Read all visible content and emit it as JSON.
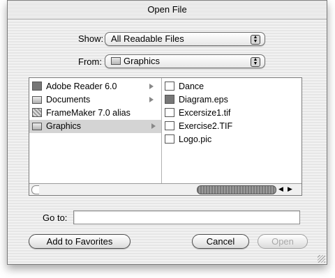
{
  "window": {
    "title": "Open File"
  },
  "show": {
    "label": "Show:",
    "value": "All Readable Files"
  },
  "from": {
    "label": "From:",
    "value": "Graphics"
  },
  "browser": {
    "column1": [
      {
        "label": "Adobe Reader 6.0",
        "icon": "app-icon"
      },
      {
        "label": "Documents",
        "icon": "folder-icon"
      },
      {
        "label": "FrameMaker 7.0 alias",
        "icon": "alias-icon"
      },
      {
        "label": "Graphics",
        "icon": "folder-icon",
        "selected": true
      }
    ],
    "column2": [
      {
        "label": "Dance",
        "icon": "document-icon"
      },
      {
        "label": "Diagram.eps",
        "icon": "eps-icon"
      },
      {
        "label": "Excersize1.tif",
        "icon": "image-icon"
      },
      {
        "label": "Exercise2.TIF",
        "icon": "image-icon"
      },
      {
        "label": "Logo.pic",
        "icon": "pict-icon"
      }
    ]
  },
  "goto": {
    "label": "Go to:",
    "value": ""
  },
  "buttons": {
    "add_favorites": "Add to Favorites",
    "cancel": "Cancel",
    "open": "Open"
  }
}
